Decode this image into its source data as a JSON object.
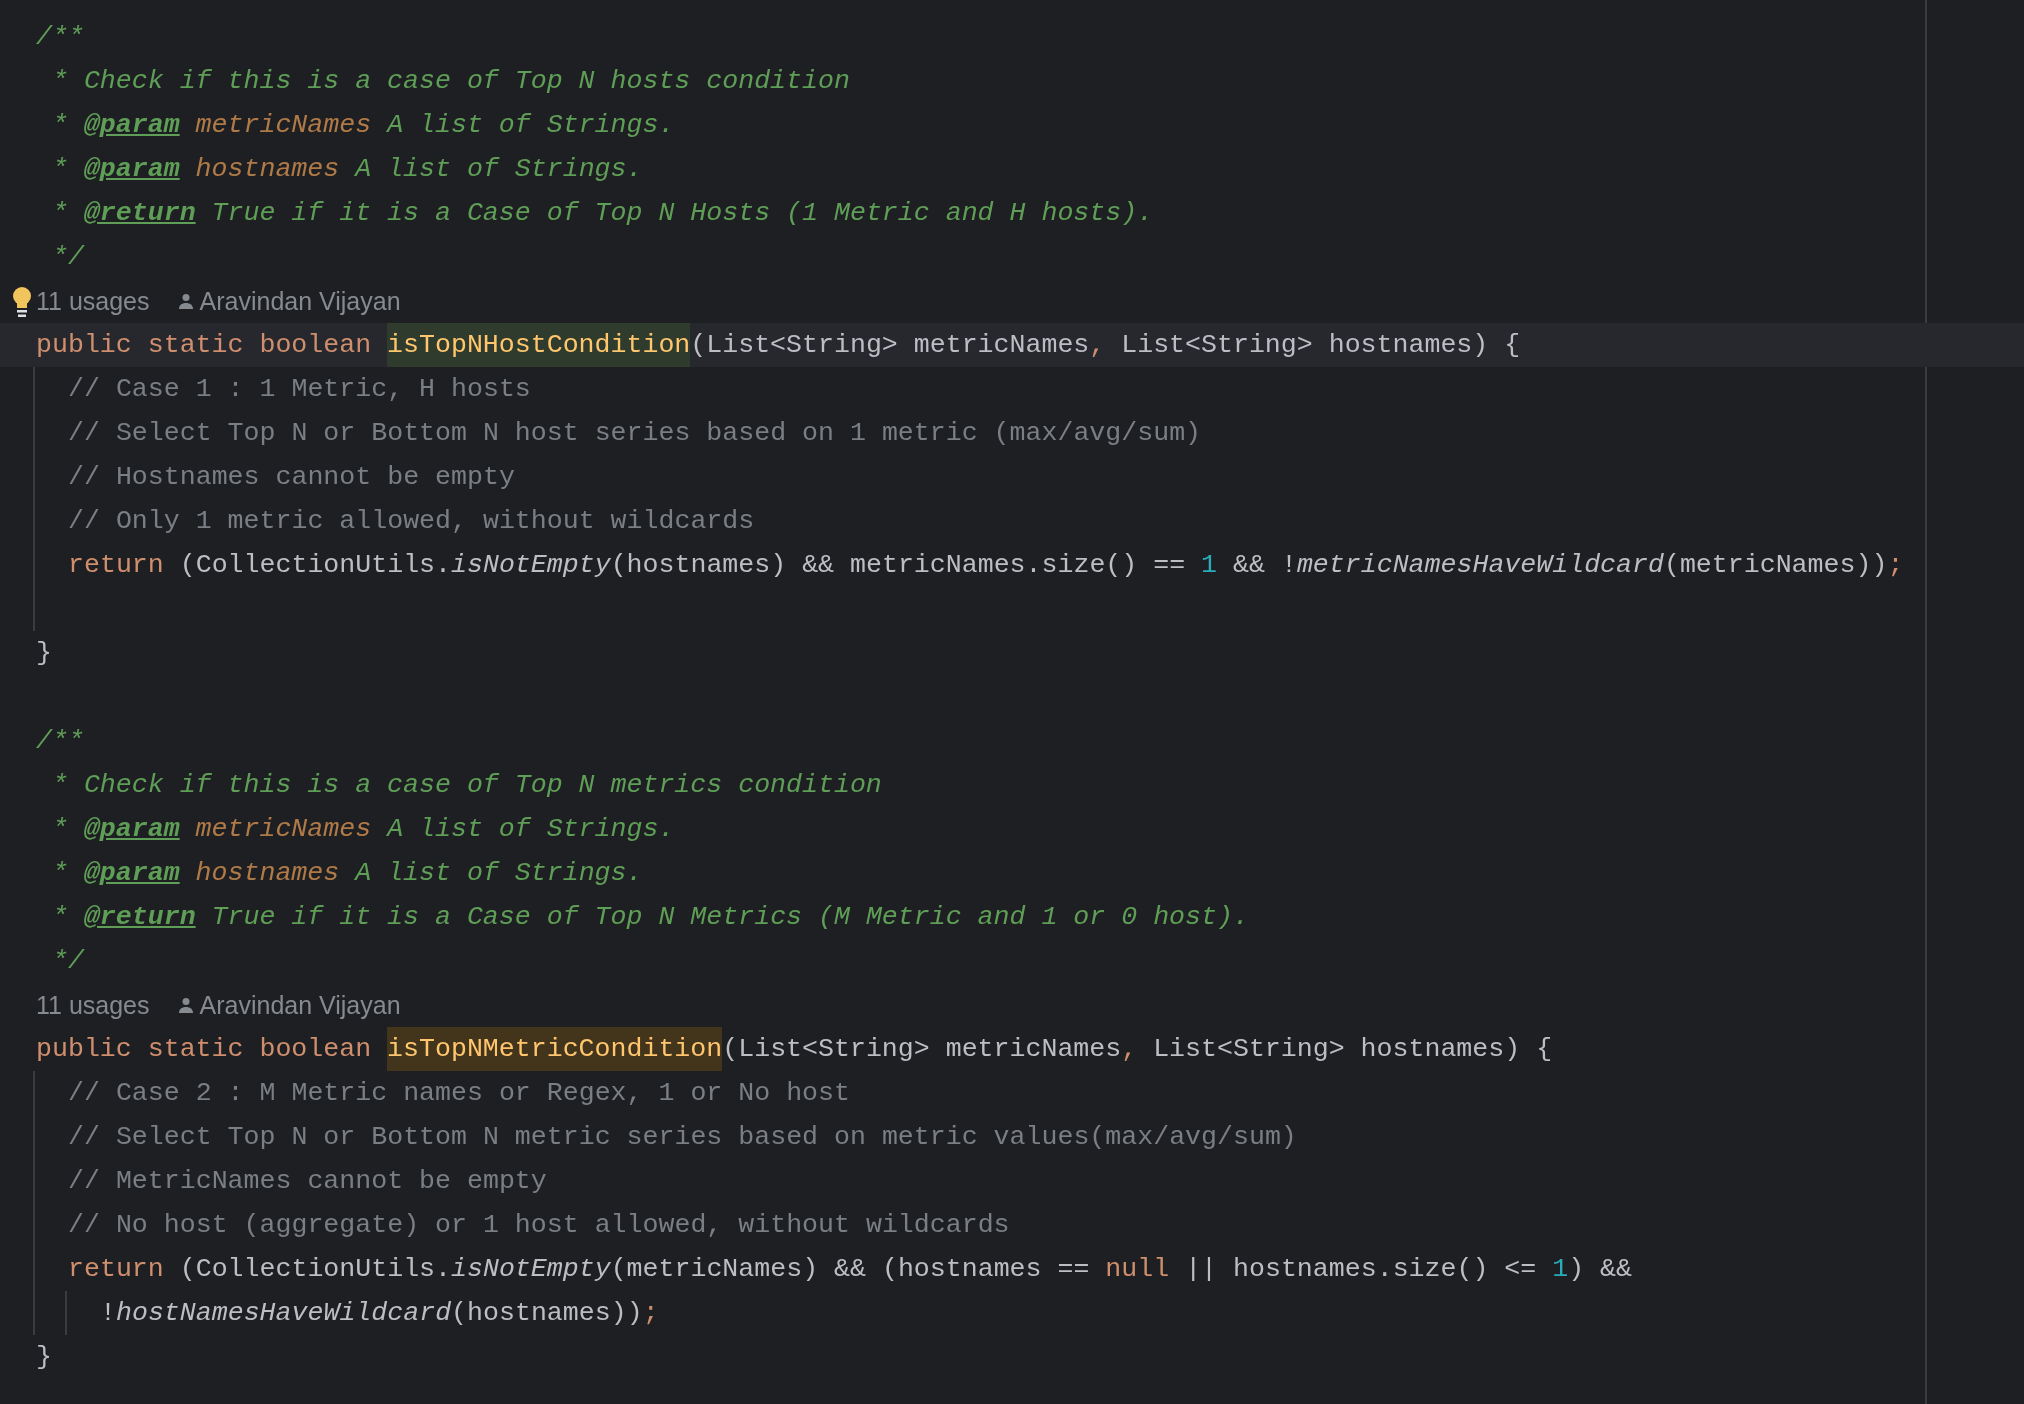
{
  "editor": {
    "lines": [
      {
        "kind": "code",
        "tokens": [
          {
            "kind": "doc",
            "text": "/**"
          }
        ]
      },
      {
        "kind": "code",
        "tokens": [
          {
            "kind": "doc",
            "text": " * Check if this is a case of Top N hosts condition"
          }
        ]
      },
      {
        "kind": "code",
        "tokens": [
          {
            "kind": "doc",
            "text": " * "
          },
          {
            "kind": "doctag",
            "text": "@param"
          },
          {
            "kind": "docparam",
            "text": " metricNames"
          },
          {
            "kind": "doc",
            "text": " A list of Strings."
          }
        ]
      },
      {
        "kind": "code",
        "tokens": [
          {
            "kind": "doc",
            "text": " * "
          },
          {
            "kind": "doctag",
            "text": "@param"
          },
          {
            "kind": "docparam",
            "text": " hostnames"
          },
          {
            "kind": "doc",
            "text": " A list of Strings."
          }
        ]
      },
      {
        "kind": "code",
        "tokens": [
          {
            "kind": "doc",
            "text": " * "
          },
          {
            "kind": "doctag",
            "text": "@return"
          },
          {
            "kind": "doc",
            "text": " True if it is a Case of Top N Hosts (1 Metric and H hosts)."
          }
        ]
      },
      {
        "kind": "code",
        "tokens": [
          {
            "kind": "doc",
            "text": " */"
          }
        ]
      },
      {
        "kind": "hint",
        "bulb": true,
        "usages": "11 usages",
        "author": "Aravindan Vijayan"
      },
      {
        "kind": "code",
        "current": true,
        "tokens": [
          {
            "kind": "keyword",
            "text": "public static boolean "
          },
          {
            "kind": "decl_read",
            "text": "isTopNHostCondition"
          },
          {
            "kind": "plain",
            "text": "(List<String> metricNames"
          },
          {
            "kind": "keyword",
            "text": ", "
          },
          {
            "kind": "plain",
            "text": "List<String> hostnames) {"
          }
        ]
      },
      {
        "kind": "body",
        "tokens": [
          {
            "kind": "comment",
            "text": "// Case 1 : 1 Metric, H hosts"
          }
        ]
      },
      {
        "kind": "body",
        "tokens": [
          {
            "kind": "comment",
            "text": "// Select Top N or Bottom N host series based on 1 metric (max/avg/sum)"
          }
        ]
      },
      {
        "kind": "body",
        "tokens": [
          {
            "kind": "comment",
            "text": "// Hostnames cannot be empty"
          }
        ]
      },
      {
        "kind": "body",
        "tokens": [
          {
            "kind": "comment",
            "text": "// Only 1 metric allowed, without wildcards"
          }
        ]
      },
      {
        "kind": "body",
        "tokens": [
          {
            "kind": "keyword",
            "text": "return "
          },
          {
            "kind": "plain",
            "text": "(CollectionUtils."
          },
          {
            "kind": "call",
            "text": "isNotEmpty"
          },
          {
            "kind": "plain",
            "text": "(hostnames) && metricNames.size() == "
          },
          {
            "kind": "number",
            "text": "1"
          },
          {
            "kind": "plain",
            "text": " && !"
          },
          {
            "kind": "call",
            "text": "metricNamesHaveWildcard"
          },
          {
            "kind": "plain",
            "text": "(metricNames))"
          },
          {
            "kind": "keyword",
            "text": ";"
          }
        ]
      },
      {
        "kind": "body"
      },
      {
        "kind": "code",
        "tokens": [
          {
            "kind": "plain",
            "text": "}"
          }
        ]
      },
      {
        "kind": "code"
      },
      {
        "kind": "code",
        "tokens": [
          {
            "kind": "doc",
            "text": "/**"
          }
        ]
      },
      {
        "kind": "code",
        "tokens": [
          {
            "kind": "doc",
            "text": " * Check if this is a case of Top N metrics condition"
          }
        ]
      },
      {
        "kind": "code",
        "tokens": [
          {
            "kind": "doc",
            "text": " * "
          },
          {
            "kind": "doctag",
            "text": "@param"
          },
          {
            "kind": "docparam",
            "text": " metricNames"
          },
          {
            "kind": "doc",
            "text": " A list of Strings."
          }
        ]
      },
      {
        "kind": "code",
        "tokens": [
          {
            "kind": "doc",
            "text": " * "
          },
          {
            "kind": "doctag",
            "text": "@param"
          },
          {
            "kind": "docparam",
            "text": " hostnames"
          },
          {
            "kind": "doc",
            "text": " A list of Strings."
          }
        ]
      },
      {
        "kind": "code",
        "tokens": [
          {
            "kind": "doc",
            "text": " * "
          },
          {
            "kind": "doctag",
            "text": "@return"
          },
          {
            "kind": "doc",
            "text": " True if it is a Case of Top N Metrics (M Metric and 1 or 0 host)."
          }
        ]
      },
      {
        "kind": "code",
        "tokens": [
          {
            "kind": "doc",
            "text": " */"
          }
        ]
      },
      {
        "kind": "hint",
        "bulb": false,
        "usages": "11 usages",
        "author": "Aravindan Vijayan"
      },
      {
        "kind": "code",
        "current": false,
        "tokens": [
          {
            "kind": "keyword",
            "text": "public static boolean "
          },
          {
            "kind": "decl_caret",
            "text": "isTopNMetricCondition"
          },
          {
            "kind": "plain",
            "text": "(List<String> metricNames"
          },
          {
            "kind": "keyword",
            "text": ", "
          },
          {
            "kind": "plain",
            "text": "List<String> hostnames) {"
          }
        ]
      },
      {
        "kind": "body",
        "tokens": [
          {
            "kind": "comment",
            "text": "// Case 2 : M Metric names or Regex, 1 or No host"
          }
        ]
      },
      {
        "kind": "body",
        "tokens": [
          {
            "kind": "comment",
            "text": "// Select Top N or Bottom N metric series based on metric values(max/avg/sum)"
          }
        ]
      },
      {
        "kind": "body",
        "tokens": [
          {
            "kind": "comment",
            "text": "// MetricNames cannot be empty"
          }
        ]
      },
      {
        "kind": "body",
        "tokens": [
          {
            "kind": "comment",
            "text": "// No host (aggregate) or 1 host allowed, without wildcards"
          }
        ]
      },
      {
        "kind": "body",
        "tokens": [
          {
            "kind": "keyword",
            "text": "return "
          },
          {
            "kind": "plain",
            "text": "(CollectionUtils."
          },
          {
            "kind": "call",
            "text": "isNotEmpty"
          },
          {
            "kind": "plain",
            "text": "(metricNames) && (hostnames == "
          },
          {
            "kind": "keyword",
            "text": "null"
          },
          {
            "kind": "plain",
            "text": " || hostnames.size() <= "
          },
          {
            "kind": "number",
            "text": "1"
          },
          {
            "kind": "plain",
            "text": ") &&"
          }
        ]
      },
      {
        "kind": "continuation",
        "tokens": [
          {
            "kind": "plain",
            "text": "!"
          },
          {
            "kind": "call",
            "text": "hostNamesHaveWildcard"
          },
          {
            "kind": "plain",
            "text": "(hostnames))"
          },
          {
            "kind": "keyword",
            "text": ";"
          }
        ]
      },
      {
        "kind": "code",
        "tokens": [
          {
            "kind": "plain",
            "text": "}"
          }
        ]
      }
    ]
  }
}
